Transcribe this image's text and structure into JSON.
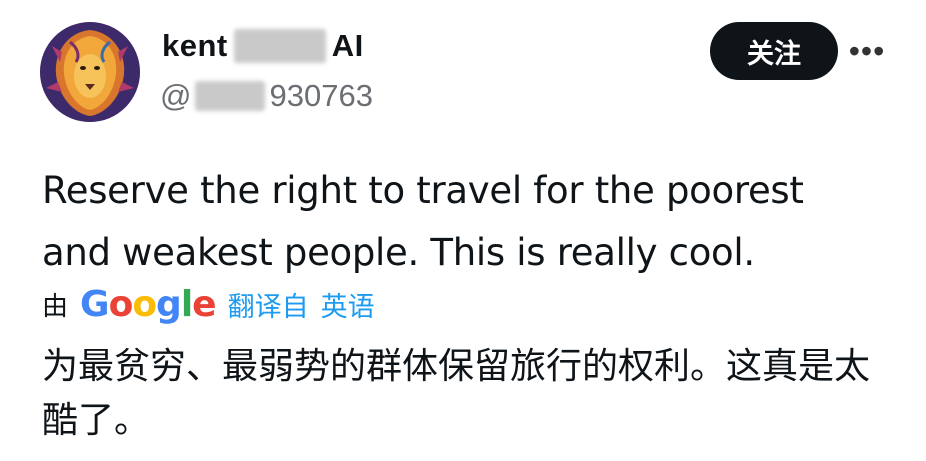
{
  "author": {
    "display_name_prefix": "kent",
    "display_name_suffix": "AI",
    "handle_prefix": "@",
    "handle_suffix": "930763"
  },
  "actions": {
    "follow_label": "关注",
    "more_label": "•••"
  },
  "tweet": {
    "text": "Reserve the right to travel for the poorest and weakest people. This is really cool."
  },
  "translation": {
    "by_label": "由",
    "provider": "Google",
    "translated_from_label": "翻译自",
    "source_language": "英语",
    "text": "为最贫穷、最弱势的群体保留旅行的权利。这真是太酷了。"
  },
  "colors": {
    "link_blue": "#1d9bf0",
    "button_bg": "#0f1419",
    "muted_text": "#6b6f74"
  },
  "icons": {
    "avatar": "lion-portrait",
    "more": "more-horizontal-icon"
  }
}
